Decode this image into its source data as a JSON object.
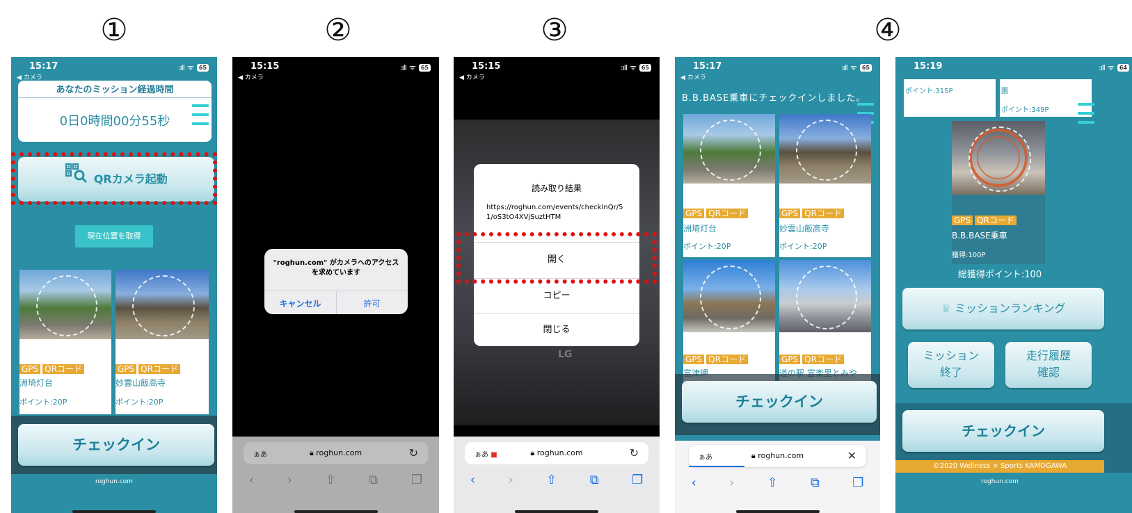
{
  "steps": [
    "①",
    "②",
    "③",
    "④"
  ],
  "status": {
    "back_label": "◀ カメラ",
    "signal": ":ıll",
    "wifi": "ᯤ",
    "battery_65": "65",
    "battery_64": "64"
  },
  "s1": {
    "time": "15:17",
    "timer_title": "あなたのミッション経過時間",
    "timer_value": "0日0時間00分55秒",
    "qr_button": "QRカメラ起動",
    "location_button": "現在位置を取得",
    "spots": [
      {
        "tags": [
          "GPS",
          "QRコード"
        ],
        "name": "洲埼灯台",
        "points": "ポイント:20P"
      },
      {
        "tags": [
          "GPS",
          "QRコード"
        ],
        "name": "妙雲山飯高寺",
        "points": "ポイント:20P"
      }
    ],
    "checkin_button": "チェックイン",
    "footer_url": "roghun.com"
  },
  "s2": {
    "time": "15:15",
    "dialog_message": "\"roghun.com\" がカメラへのアクセスを求めています",
    "cancel": "キャンセル",
    "allow": "許可",
    "url_aa": "ぁあ",
    "url_host": "roghun.com"
  },
  "s3": {
    "time": "15:15",
    "result_title": "読み取り結果",
    "result_url": "https://roghun.com/events/checkInQr/51/oS3tO4XVjSuztHTM",
    "open": "開く",
    "copy": "コピー",
    "close": "閉じる",
    "url_aa": "ぁあ",
    "url_host": "roghun.com",
    "screen_brand": "LG"
  },
  "s4a": {
    "time": "15:17",
    "checkin_message": "B.B.BASE乗車にチェックインしました。",
    "spots": [
      {
        "tags": [
          "GPS",
          "QRコード"
        ],
        "name": "洲埼灯台",
        "points": "ポイント:20P"
      },
      {
        "tags": [
          "GPS",
          "QRコード"
        ],
        "name": "妙雲山飯高寺",
        "points": "ポイント:20P"
      },
      {
        "tags": [
          "GPS",
          "QRコード"
        ],
        "name": "富津岬",
        "points": ""
      },
      {
        "tags": [
          "GPS",
          "QRコード"
        ],
        "name": "道の駅 富楽里とみや",
        "points": ""
      }
    ],
    "checkin_button": "チェックイン",
    "url_aa": "ぁあ",
    "url_host": "roghun.com"
  },
  "s4b": {
    "time": "15:19",
    "box_left": "ポイント:315P",
    "box_right_top": "園",
    "box_right": "ポイント:349P",
    "spot": {
      "tags": [
        "GPS",
        "QRコード"
      ],
      "name": "B.B.BASE乗車",
      "points": "獲得:100P"
    },
    "total_points": "総獲得ポイント:100",
    "ranking_button": "ミッションランキング",
    "end_button": "ミッション\n終了",
    "end_line1": "ミッション",
    "end_line2": "終了",
    "history_line1": "走行履歴",
    "history_line2": "確認",
    "checkin_button": "チェックイン",
    "copyright": "©2020 Wellness × Sports KAMOGAWA",
    "footer_url": "roghun.com"
  }
}
